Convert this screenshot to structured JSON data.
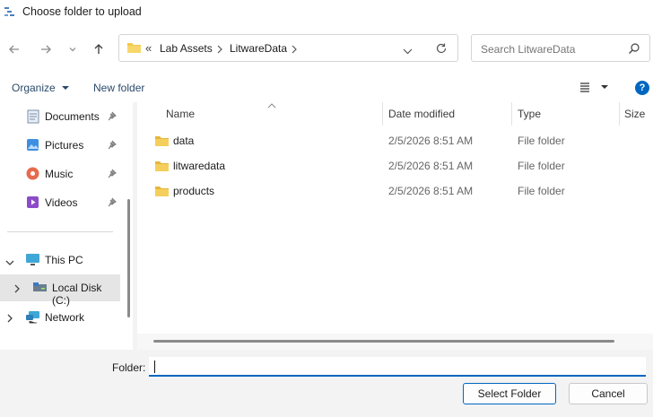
{
  "window": {
    "title": "Choose folder to upload"
  },
  "address": {
    "overflow": "«",
    "crumbs": [
      "Lab Assets",
      "LitwareData"
    ]
  },
  "search": {
    "placeholder": "Search LitwareData"
  },
  "commands": {
    "organize": "Organize",
    "new_folder": "New folder"
  },
  "sidebar": {
    "items": [
      {
        "label": "Documents",
        "icon": "documents-icon",
        "pinned": true
      },
      {
        "label": "Pictures",
        "icon": "pictures-icon",
        "pinned": true
      },
      {
        "label": "Music",
        "icon": "music-icon",
        "pinned": true
      },
      {
        "label": "Videos",
        "icon": "videos-icon",
        "pinned": true
      },
      {
        "label": "This PC",
        "icon": "computer-icon"
      },
      {
        "label": "Local Disk (C:)",
        "icon": "drive-icon",
        "selected": true
      },
      {
        "label": "Network",
        "icon": "network-icon"
      }
    ]
  },
  "columns": [
    "Name",
    "Date modified",
    "Type",
    "Size"
  ],
  "files": [
    {
      "name": "data",
      "modified": "2/5/2026 8:51 AM",
      "type": "File folder"
    },
    {
      "name": "litwaredata",
      "modified": "2/5/2026 8:51 AM",
      "type": "File folder"
    },
    {
      "name": "products",
      "modified": "2/5/2026 8:51 AM",
      "type": "File folder"
    }
  ],
  "footer": {
    "folder_label": "Folder:",
    "folder_value": "",
    "select_button": "Select Folder",
    "cancel_button": "Cancel"
  },
  "colors": {
    "accent": "#0067c0",
    "folder": "#f2c94c",
    "selected_bg": "#e5e5e5"
  }
}
